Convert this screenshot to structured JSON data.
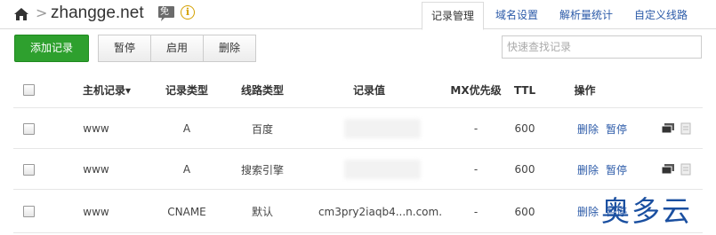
{
  "header": {
    "domain": "zhangge.net",
    "separator": ">",
    "badge_text": "免",
    "info_text": "i"
  },
  "tabs": [
    {
      "label": "记录管理",
      "active": true
    },
    {
      "label": "域名设置",
      "active": false
    },
    {
      "label": "解析量统计",
      "active": false
    },
    {
      "label": "自定义线路",
      "active": false
    }
  ],
  "toolbar": {
    "add_label": "添加记录",
    "pause_label": "暂停",
    "enable_label": "启用",
    "delete_label": "删除",
    "search_placeholder": "快速查找记录"
  },
  "table": {
    "columns": [
      "主机记录▾",
      "记录类型",
      "线路类型",
      "记录值",
      "MX优先级",
      "TTL",
      "操作"
    ],
    "rows": [
      {
        "host": "www",
        "type": "A",
        "line": "百度",
        "value": "",
        "mx": "-",
        "ttl": "600",
        "delete": "删除",
        "pause": "暂停"
      },
      {
        "host": "www",
        "type": "A",
        "line": "搜索引擎",
        "value": "",
        "mx": "-",
        "ttl": "600",
        "delete": "删除",
        "pause": "暂停"
      },
      {
        "host": "www",
        "type": "CNAME",
        "line": "默认",
        "value": "cm3pry2iaqb4...n.com.",
        "mx": "-",
        "ttl": "600",
        "delete": "删除",
        "pause": "暂停"
      }
    ]
  },
  "watermark": "奥多云",
  "colors": {
    "accent_green": "#2ea02e",
    "link_blue": "#2b5aa8",
    "badge_gray": "#6b6b6b",
    "info_gold": "#d4a000"
  }
}
